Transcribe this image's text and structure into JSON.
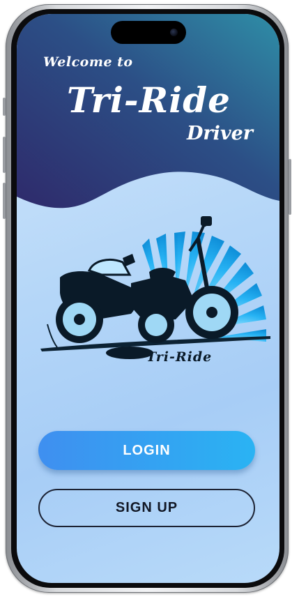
{
  "header": {
    "welcome_text": "Welcome to",
    "app_name": "Tri-Ride",
    "role": "Driver"
  },
  "logo": {
    "icon": "sidecar-motorcycle-logo-icon",
    "wordmark": "Tri-Ride"
  },
  "actions": {
    "login_label": "LOGIN",
    "signup_label": "SIGN UP"
  },
  "colors": {
    "header_gradient_start": "#2e2a6b",
    "header_gradient_end": "#2f8ea7",
    "primary_button_start": "#3f8ff0",
    "primary_button_end": "#2ab3f3",
    "accent_rays": "#20aef3",
    "background": "#b4d6f8"
  }
}
